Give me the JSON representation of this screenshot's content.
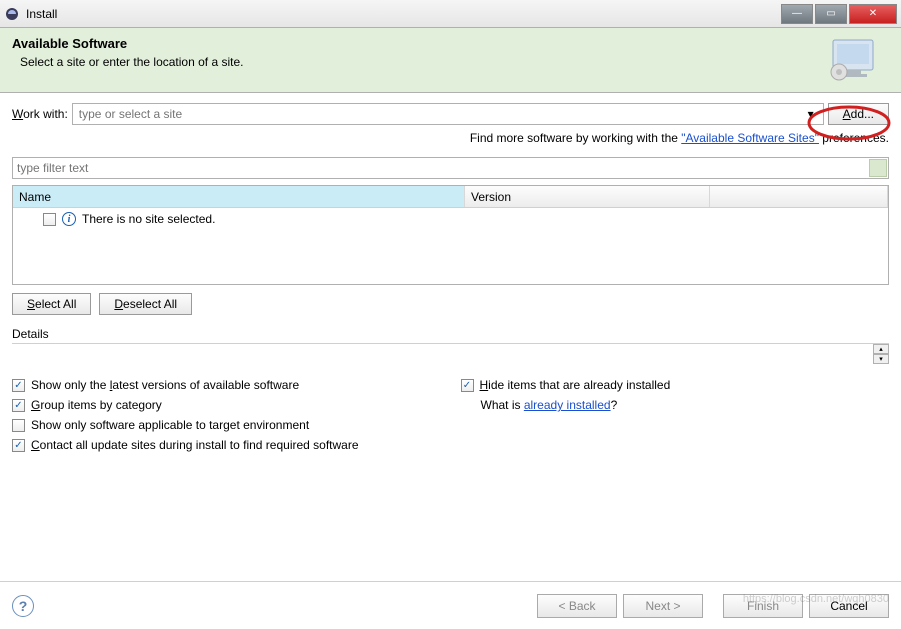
{
  "window": {
    "title": "Install"
  },
  "header": {
    "title": "Available Software",
    "subtitle": "Select a site or enter the location of a site."
  },
  "work_with": {
    "label_pre": "W",
    "label_rest": "ork with:",
    "placeholder": "type or select a site",
    "add_label": "Add..."
  },
  "find_more": {
    "prefix": "Find more software by working with the ",
    "link": "\"Available Software Sites\"",
    "suffix": " preferences."
  },
  "filter": {
    "placeholder": "type filter text"
  },
  "table": {
    "columns": {
      "name": "Name",
      "version": "Version"
    },
    "empty_message": "There is no site selected."
  },
  "buttons": {
    "select_all": "Select All",
    "deselect_all": "Deselect All"
  },
  "details": {
    "label": "Details"
  },
  "options": {
    "show_latest": {
      "checked": true,
      "pre": "Show only the ",
      "u": "l",
      "post": "atest versions of available software"
    },
    "hide_installed": {
      "checked": true,
      "u": "H",
      "post": "ide items that are already installed"
    },
    "group_category": {
      "checked": true,
      "u": "G",
      "post": "roup items by category"
    },
    "what_is_pre": "What is ",
    "what_is_link": "already installed",
    "what_is_post": "?",
    "applicable": {
      "checked": false,
      "label": "Show only software applicable to target environment"
    },
    "contact_sites": {
      "checked": true,
      "u": "C",
      "post": "ontact all update sites during install to find required software"
    }
  },
  "footer": {
    "back": "< Back",
    "next": "Next >",
    "finish": "Finish",
    "cancel": "Cancel"
  },
  "watermark": "https://blog.csdn.net/wqh0830"
}
